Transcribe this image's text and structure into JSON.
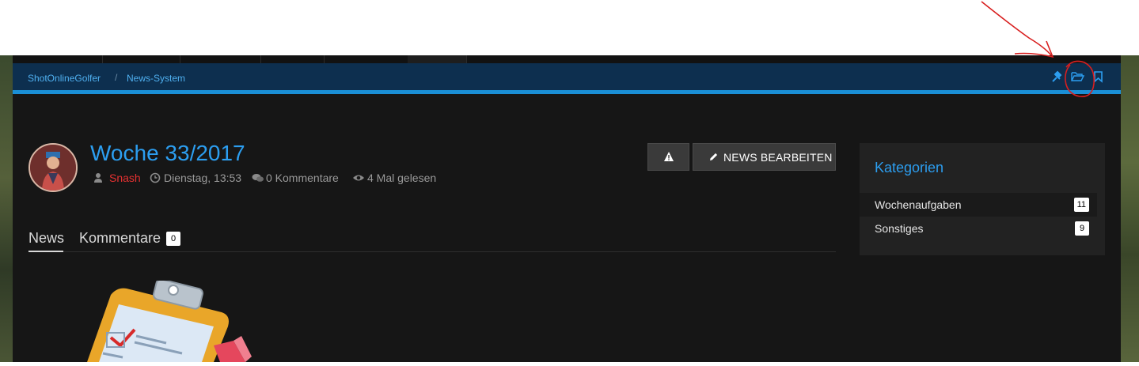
{
  "breadcrumb": {
    "items": [
      "ShotOnlineGolfer",
      "News-System"
    ],
    "separator": "/"
  },
  "toolbar_icons": [
    "unpin-icon",
    "folder-open-icon",
    "bookmark-icon"
  ],
  "article": {
    "title": "Woche 33/2017",
    "author": "Snash",
    "date": "Dienstag, 13:53",
    "comments": "0 Kommentare",
    "views": "4 Mal gelesen"
  },
  "actions": {
    "warn_icon": "warning-icon",
    "edit_label": "NEWS BEARBEITEN"
  },
  "tabs": [
    {
      "label": "News",
      "active": true
    },
    {
      "label": "Kommentare",
      "count": "0"
    }
  ],
  "sidebar": {
    "title": "Kategorien",
    "categories": [
      {
        "label": "Wochenaufgaben",
        "count": "11"
      },
      {
        "label": "Sonstiges",
        "count": "9"
      }
    ]
  },
  "colors": {
    "accent": "#2c9ef0",
    "author": "#e53131",
    "breadcrumb_bar": "#0d2f4f",
    "annotation": "#d81f1f"
  }
}
